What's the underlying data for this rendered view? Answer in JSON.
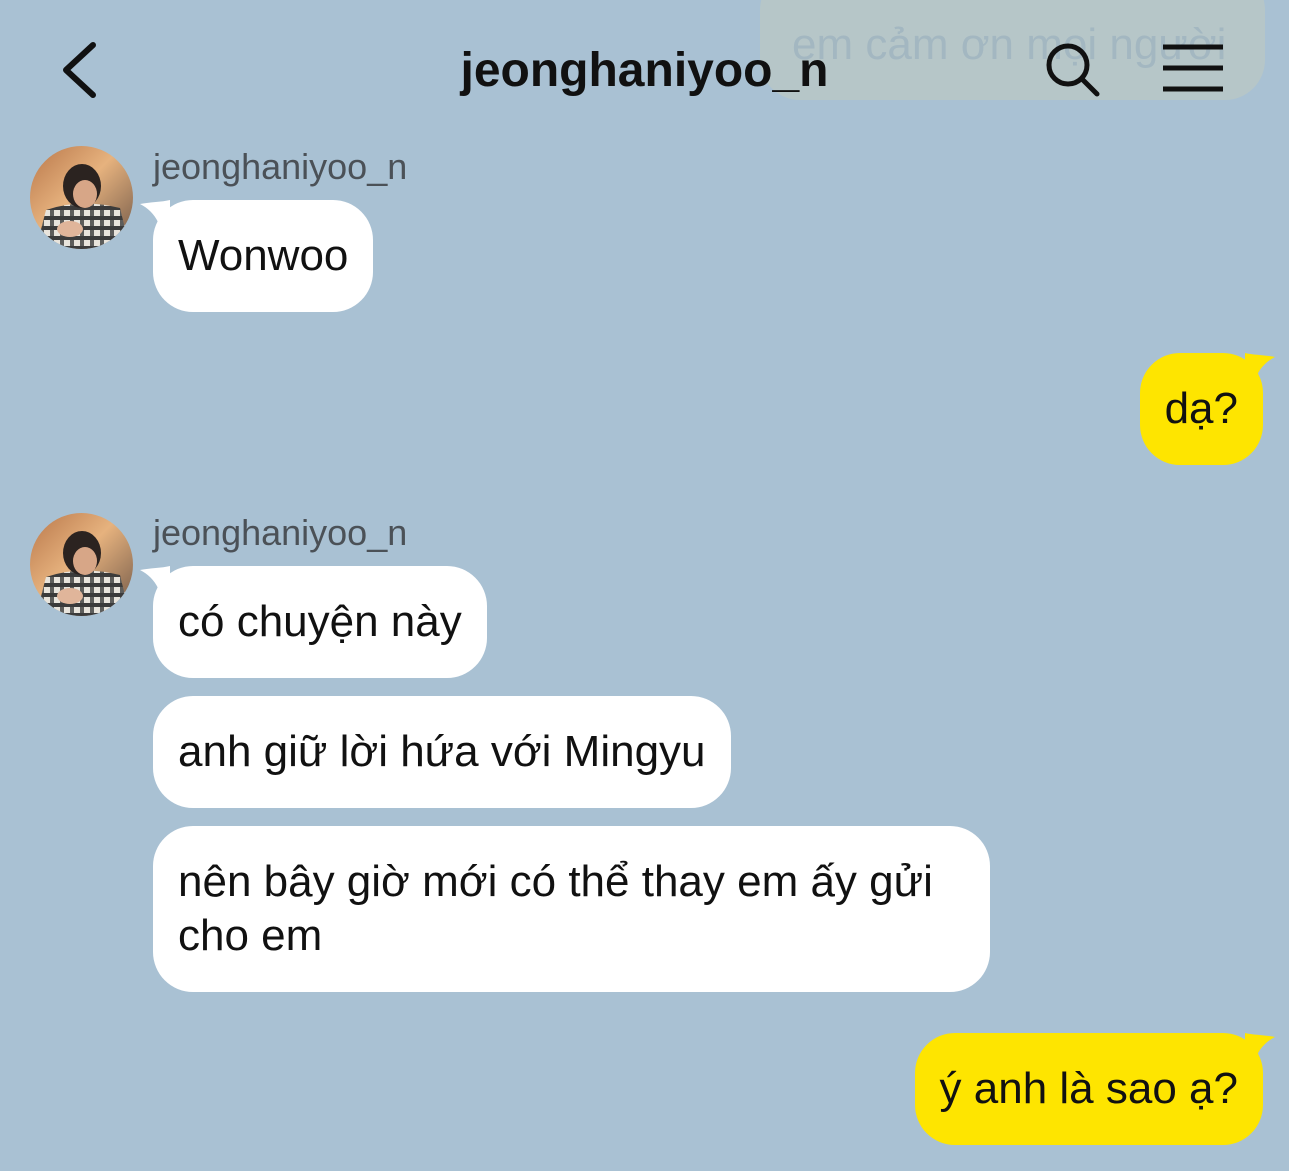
{
  "header": {
    "title": "jeonghaniyoo_n",
    "back_icon": "chevron-left-icon",
    "search_icon": "search-icon",
    "menu_icon": "hamburger-menu-icon"
  },
  "faded_message": {
    "text": "em cảm ơn mọi người"
  },
  "conversation": [
    {
      "side": "received",
      "sender": "jeonghaniyoo_n",
      "bubbles": [
        "Wonwoo"
      ]
    },
    {
      "side": "sent",
      "bubbles": [
        "dạ?"
      ]
    },
    {
      "side": "received",
      "sender": "jeonghaniyoo_n",
      "bubbles": [
        "có chuyện này",
        "anh giữ lời hứa với Mingyu",
        "nên bây giờ mới có thể thay em ấy gửi cho em"
      ]
    },
    {
      "side": "sent",
      "bubbles": [
        "ý anh là sao ạ?"
      ]
    }
  ],
  "colors": {
    "background": "#a9c1d3",
    "received_bubble": "#ffffff",
    "sent_bubble": "#fee500",
    "text": "#111111",
    "sender_name": "#4b5157"
  }
}
